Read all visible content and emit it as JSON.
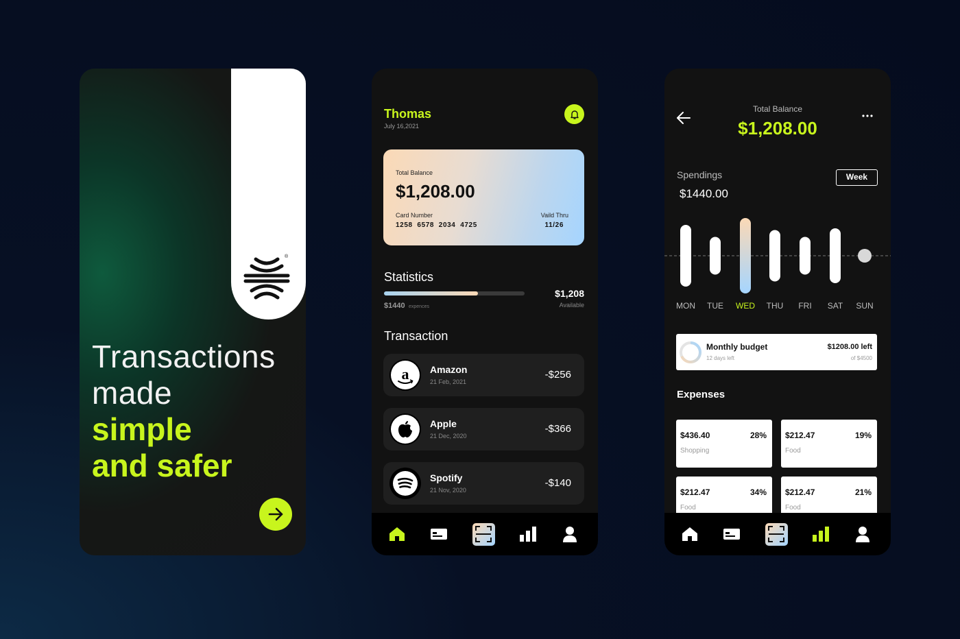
{
  "colors": {
    "accent": "#c8f51d",
    "background": "#050c1e",
    "phone": "#121212",
    "card_gradient_start": "#fbd9b6",
    "card_gradient_end": "#a5d5ff"
  },
  "onboarding": {
    "logo": "abstract-stripes-logo",
    "registered_mark": "®",
    "line1": "Transactions",
    "line2": "made",
    "line3": "simple",
    "line4": "and safer",
    "next_icon": "arrow-right-icon"
  },
  "home": {
    "user_name": "Thomas",
    "date": "July 16,2021",
    "bell_icon": "bell-icon",
    "card": {
      "balance_label": "Total Balance",
      "balance": "$1,208.00",
      "number_label": "Card Number",
      "number": "1258  6578  2034  4725",
      "valid_label": "Vaild Thru",
      "valid": "11/26"
    },
    "statistics": {
      "title": "Statistics",
      "spent_fraction": 0.67,
      "expenses_amount": "$1440",
      "expenses_label": "expences",
      "available_amount": "$1,208",
      "available_label": "Available"
    },
    "transactions_title": "Transaction",
    "transactions": [
      {
        "name": "Amazon",
        "date": "21 Feb, 2021",
        "amount": "-$256",
        "icon": "amazon-icon"
      },
      {
        "name": "Apple",
        "date": "21 Dec, 2020",
        "amount": "-$366",
        "icon": "apple-icon"
      },
      {
        "name": "Spotify",
        "date": "21 Nov, 2020",
        "amount": "-$140",
        "icon": "spotify-icon"
      }
    ]
  },
  "nav": {
    "items": [
      "home-icon",
      "card-icon",
      "scan-icon",
      "stats-icon",
      "profile-icon"
    ]
  },
  "stats": {
    "total_label": "Total Balance",
    "total_value": "$1,208.00",
    "spendings_label": "Spendings",
    "spendings_value": "$1440.00",
    "period_button": "Week",
    "more_icon": "more-horizontal-icon",
    "back_icon": "arrow-left-icon",
    "budget": {
      "title": "Monthly budget",
      "days_left": "12 days left",
      "left": "$1208.00 left",
      "of": "of $4500"
    },
    "expenses_title": "Expenses",
    "expenses": [
      {
        "amount": "$436.40",
        "percent": "28%",
        "category": "Shopping"
      },
      {
        "amount": "$212.47",
        "percent": "19%",
        "category": "Food"
      },
      {
        "amount": "$212.47",
        "percent": "34%",
        "category": "Food"
      },
      {
        "amount": "$212.47",
        "percent": "21%",
        "category": "Food"
      }
    ]
  },
  "chart_data": {
    "type": "bar",
    "categories": [
      "MON",
      "TUE",
      "WED",
      "THU",
      "FRI",
      "SAT",
      "SUN"
    ],
    "values": [
      90,
      55,
      110,
      75,
      55,
      80,
      0
    ],
    "highlight": "WED",
    "ylim": [
      0,
      110
    ],
    "grid": false
  }
}
